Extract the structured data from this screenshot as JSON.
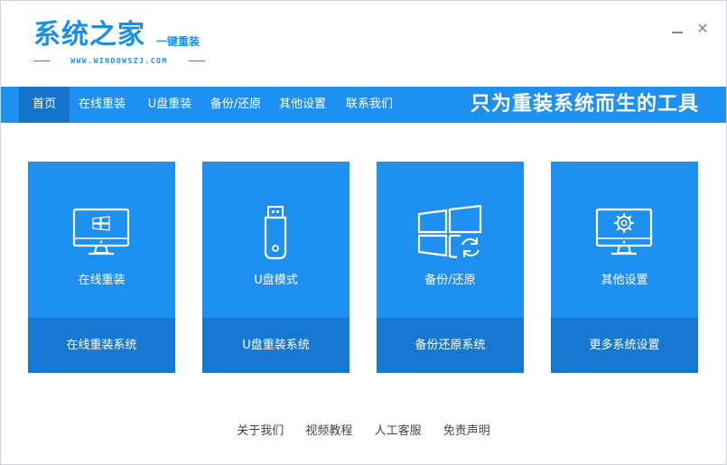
{
  "app": {
    "logo_title": "系统之家",
    "logo_subtitle": "一键重装",
    "logo_url": "WWW.WINDOWSZJ.COM"
  },
  "window_controls": {
    "minimize_icon": "minimize-icon",
    "close_icon": "close-icon",
    "close_glyph": "✕"
  },
  "nav": {
    "items": [
      {
        "label": "首页",
        "active": true
      },
      {
        "label": "在线重装",
        "active": false
      },
      {
        "label": "U盘重装",
        "active": false
      },
      {
        "label": "备份/还原",
        "active": false
      },
      {
        "label": "其他设置",
        "active": false
      },
      {
        "label": "联系我们",
        "active": false
      }
    ],
    "slogan": "只为重装系统而生的工具"
  },
  "cards": [
    {
      "label": "在线重装",
      "action": "在线重装系统",
      "icon": "monitor-windows-icon"
    },
    {
      "label": "U盘模式",
      "action": "U盘重装系统",
      "icon": "usb-drive-icon"
    },
    {
      "label": "备份/还原",
      "action": "备份还原系统",
      "icon": "windows-sync-icon"
    },
    {
      "label": "其他设置",
      "action": "更多系统设置",
      "icon": "monitor-gear-icon"
    }
  ],
  "footer": {
    "links": [
      "关于我们",
      "视频教程",
      "人工客服",
      "免责声明"
    ]
  },
  "colors": {
    "accent": "#1e90f2",
    "accent_dark": "#1678d1",
    "nav_active": "#1674cc",
    "text_muted": "#444444"
  }
}
